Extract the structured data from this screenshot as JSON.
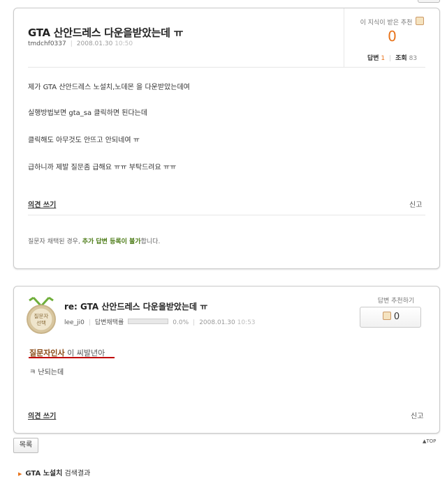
{
  "question": {
    "title": "GTA 산안드레스 다운을받았는데 ㅠ",
    "author": "tmdchf0337",
    "date": "2008.01.30",
    "time": "10:50",
    "recommend_label": "이 지식이 받은 추천",
    "recommend_count": "0",
    "answers_label": "답변",
    "answers_count": "1",
    "views_label": "조회",
    "views_count": "83",
    "body": [
      "제가 GTA 산안드레스 노설치,노데몬 을 다운받았는데여",
      "실행방법보면 gta_sa 클릭하면 된다는데",
      "클릭해도 아무것도 안뜨고 안되네여 ㅠ",
      "급하니까 제발 질문좀 급해요 ㅠㅠ 부탁드려요 ㅠㅠ"
    ],
    "opinion_label": "의견 쓰기",
    "report_label": "신고",
    "notice_prefix": "질문자 채택된 경우, ",
    "notice_highlight": "추가 답변 등록이 불가",
    "notice_suffix": "합니다."
  },
  "answer": {
    "badge_text": [
      "질문자",
      "선택"
    ],
    "title": "re: GTA 산안드레스 다운을받았는데 ㅠ",
    "author": "lee_ji0",
    "adoption_label": "답변채택률",
    "adoption_rate": "0.0%",
    "adoption_fraction": 0.0,
    "date": "2008.01.30",
    "time": "10:53",
    "vote_label": "답변 추천하기",
    "vote_count": "0",
    "greeting_bold": "질문자인사",
    "greeting_rest": " 이 씨발년아",
    "body": "ㅋ 난되는데",
    "opinion_label": "의견 쓰기",
    "report_label": "신고"
  },
  "footer": {
    "list_button": "목록",
    "top_link": "TOP",
    "search_bold": "GTA 노설치",
    "search_rest": " 검색결과"
  },
  "colors": {
    "accent_orange": "#e8731a",
    "notice_green": "#4a7a14",
    "underline_red": "#c00000",
    "medal_gold": "#c9b48a"
  }
}
